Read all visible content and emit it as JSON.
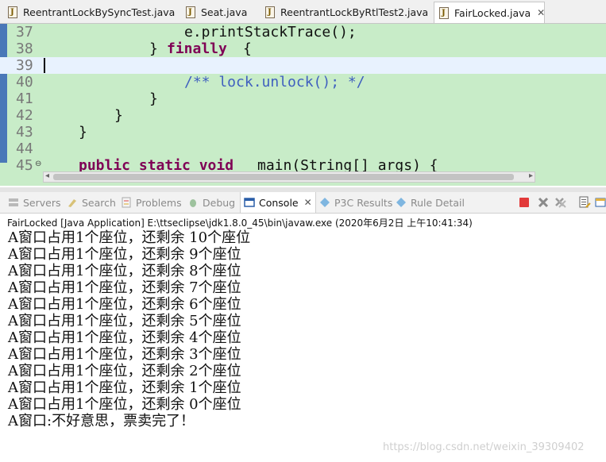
{
  "editor_tabs": [
    {
      "label": "ReentrantLockBySyncTest.java",
      "active": false
    },
    {
      "label": "Seat.java",
      "active": false
    },
    {
      "label": "ReentrantLockByRtlTest2.java",
      "active": false
    },
    {
      "label": "FairLocked.java",
      "active": true,
      "close": "✕"
    }
  ],
  "editor": {
    "lines": [
      {
        "num": "37",
        "code": "e.printStackTrace();"
      },
      {
        "num": "38",
        "pre": "}",
        "kw": "finally",
        "post": "{"
      },
      {
        "num": "39",
        "code": ""
      },
      {
        "num": "40",
        "comment": "/** lock.unlock(); */"
      },
      {
        "num": "41",
        "code": "}"
      },
      {
        "num": "42",
        "code": "}"
      },
      {
        "num": "43",
        "code": "}"
      },
      {
        "num": "44",
        "code": ""
      },
      {
        "num": "45",
        "kw": "public static void",
        "post": "main(String[] args) {"
      }
    ]
  },
  "views": {
    "tabs": [
      {
        "label": "Servers",
        "icon": "servers-icon"
      },
      {
        "label": "Search",
        "icon": "search-icon"
      },
      {
        "label": "Problems",
        "icon": "problems-icon"
      },
      {
        "label": "Debug",
        "icon": "debug-icon"
      },
      {
        "label": "Console",
        "icon": "console-icon",
        "active": true,
        "close": "✕"
      },
      {
        "label": "P3C Results",
        "icon": "p3c-icon"
      },
      {
        "label": "Rule Detail",
        "icon": "rule-detail-icon"
      }
    ],
    "toolbar": [
      "terminate-icon",
      "remove-launch-icon",
      "remove-all-icon",
      "pin-icon",
      "display-console-icon"
    ]
  },
  "console": {
    "title": "FairLocked [Java Application] E:\\ttseclipse\\jdk1.8.0_45\\bin\\javaw.exe (2020年6月2日 上午10:41:34)",
    "lines": [
      "A窗口占用1个座位，还剩余 10个座位",
      "A窗口占用1个座位，还剩余 9个座位",
      "A窗口占用1个座位，还剩余 8个座位",
      "A窗口占用1个座位，还剩余 7个座位",
      "A窗口占用1个座位，还剩余 6个座位",
      "A窗口占用1个座位，还剩余 5个座位",
      "A窗口占用1个座位，还剩余 4个座位",
      "A窗口占用1个座位，还剩余 3个座位",
      "A窗口占用1个座位，还剩余 2个座位",
      "A窗口占用1个座位，还剩余 1个座位",
      "A窗口占用1个座位，还剩余 0个座位",
      "A窗口:不好意思，票卖完了！"
    ]
  },
  "watermark": "https://blog.csdn.net/weixin_39309402",
  "colors": {
    "editor_bg": "#c8ecc8",
    "keyword": "#7f0055",
    "comment": "#3f5fbf",
    "current_line": "#e8f2fe",
    "terminate": "#e23a3a"
  }
}
